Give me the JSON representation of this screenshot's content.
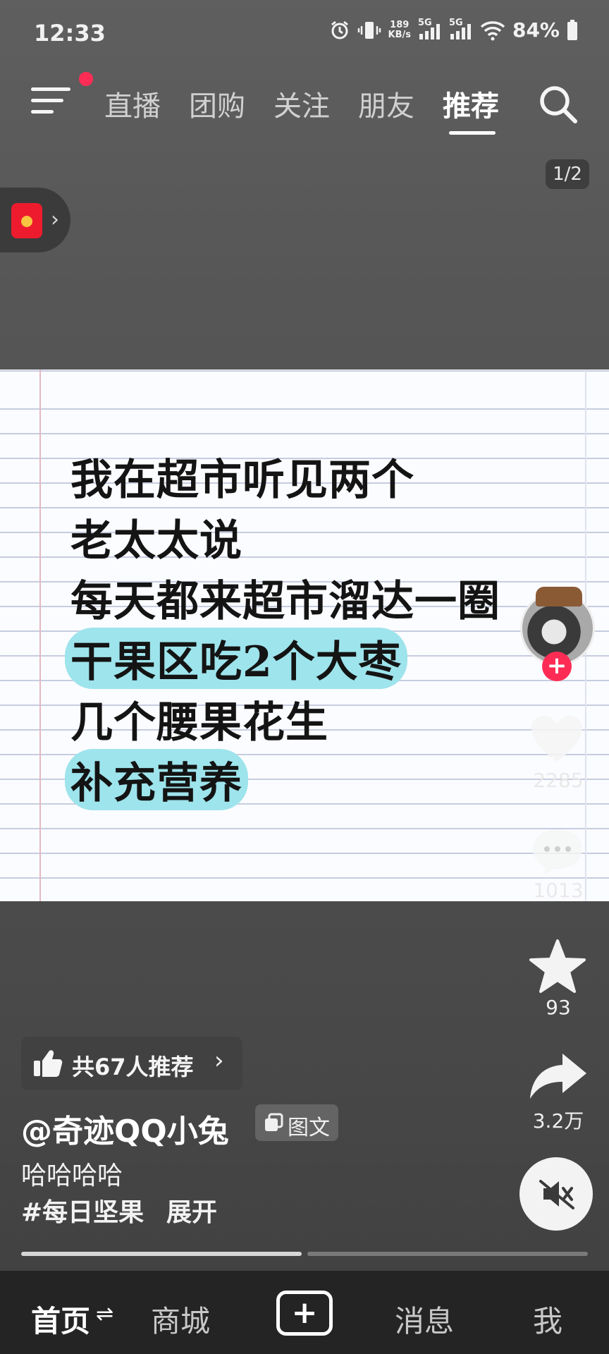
{
  "status_bar": {
    "time": "12:33",
    "network_speed_value": "189",
    "network_speed_unit": "KB/s",
    "signal_label_1": "5G",
    "signal_label_2": "5G",
    "battery": "84%"
  },
  "top_nav": {
    "tabs": [
      {
        "label": "直播"
      },
      {
        "label": "团购"
      },
      {
        "label": "关注"
      },
      {
        "label": "朋友"
      },
      {
        "label": "推荐",
        "active": true
      }
    ],
    "notification_dot": true
  },
  "page_indicator": "1/2",
  "note_image": {
    "lines": [
      {
        "text": "我在超市听见两个",
        "highlight": false
      },
      {
        "text": "老太太说",
        "highlight": false
      },
      {
        "text": "每天都来超市溜达一圈",
        "highlight": false
      },
      {
        "text": "干果区吃2个大枣",
        "highlight": true
      },
      {
        "text": "几个腰果花生",
        "highlight": false
      },
      {
        "text": "补充营养",
        "highlight": true
      }
    ],
    "highlight_color": "#9ee4ec"
  },
  "right_rail": {
    "follow_symbol": "+",
    "like_count": "2285",
    "comment_count": "1013",
    "favorite_count": "93",
    "share_count": "3.2万"
  },
  "post": {
    "recommend_text": "共67人推荐",
    "recommend_chevron": "›",
    "author": "@奇迹QQ小兔",
    "post_type": "图文",
    "caption": "哈哈哈哈",
    "hashtag": "#每日坚果",
    "expand": "展开",
    "image_progress": {
      "current": 1,
      "total": 2
    }
  },
  "bottom_nav": {
    "home": "首页",
    "home_toggle": "⇌",
    "mall": "商城",
    "create": "+",
    "messages": "消息",
    "me": "我"
  },
  "colors": {
    "accent_red": "#fe2c55",
    "background": "#555555"
  }
}
